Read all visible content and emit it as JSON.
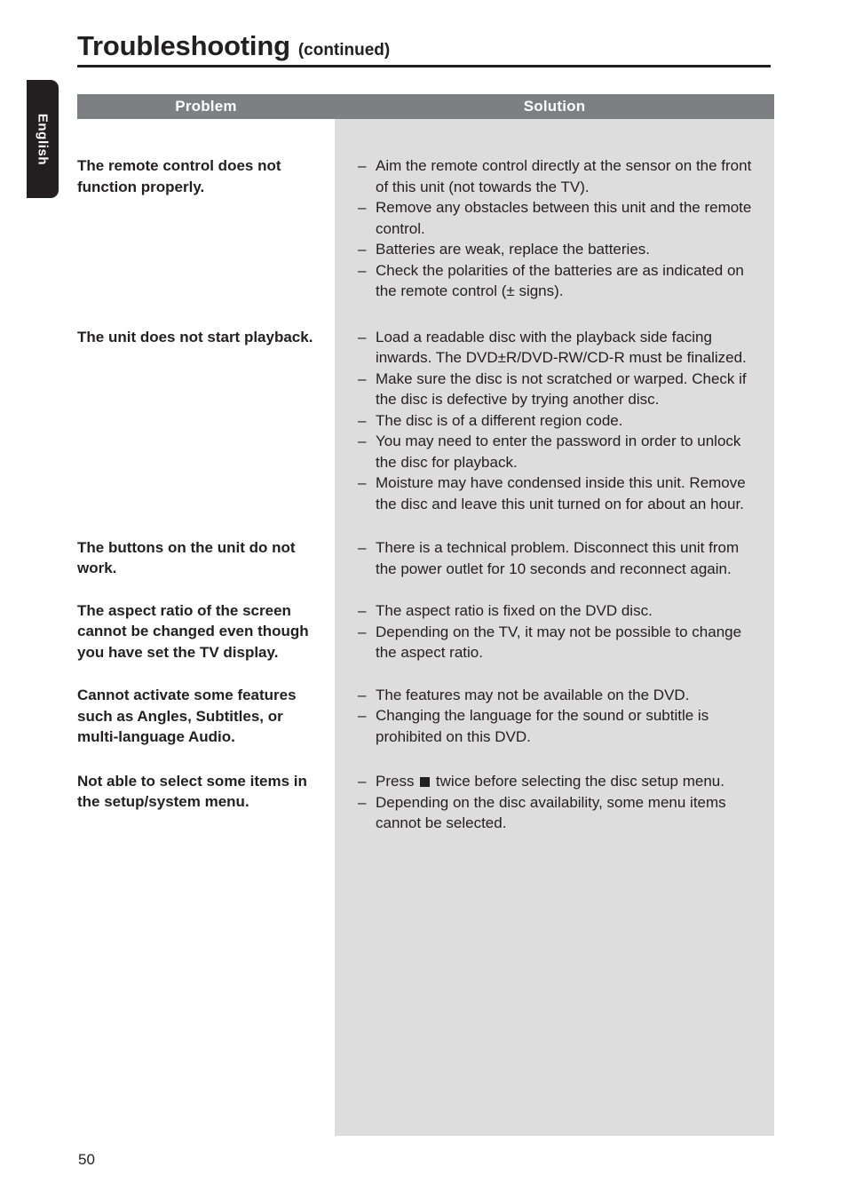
{
  "document": {
    "title": "Troubleshooting",
    "title_suffix": "(continued)",
    "page_number": "50",
    "language_tab": "English",
    "colors": {
      "header_bar": "#7d7f82",
      "solution_column": "#dddddd",
      "text": "#231f20",
      "tab": "#231f20"
    }
  },
  "table": {
    "headers": {
      "problem": "Problem",
      "solution": "Solution"
    },
    "rows": [
      {
        "problem": "The remote control does not function properly.",
        "solutions": [
          "Aim the remote control directly at the sensor on the front of this unit (not towards the TV).",
          "Remove any obstacles between this unit and the remote control.",
          "Batteries are weak, replace the batteries.",
          "Check the polarities of the batteries are as indicated on the remote control (± signs)."
        ]
      },
      {
        "problem": "The unit does not start playback.",
        "solutions": [
          "Load a readable disc with the playback side facing inwards. The DVD±R/DVD-RW/CD-R must be finalized.",
          "Make sure the disc is not scratched or warped. Check if the disc is defective by trying another disc.",
          "The disc is of a different region code.",
          "You may need to enter the password in order to unlock the disc for playback.",
          "Moisture may have condensed inside this unit. Remove the disc and leave this unit turned on for about an hour."
        ]
      },
      {
        "problem": "The buttons on the unit do not work.",
        "solutions": [
          "There is a technical problem. Disconnect this unit from the power outlet for 10 seconds and reconnect again."
        ]
      },
      {
        "problem": "The aspect ratio of the screen cannot be changed even though you have set the TV display.",
        "solutions": [
          "The aspect ratio is fixed on the DVD disc.",
          "Depending on the TV, it may not be possible to change the aspect ratio."
        ]
      },
      {
        "problem": "Cannot activate some features such as Angles, Subtitles, or multi-language Audio.",
        "solutions": [
          "The features may not be available on the DVD.",
          "Changing the language for the sound or subtitle is prohibited on this DVD."
        ]
      },
      {
        "problem": "Not able to select some items in the setup/system menu.",
        "solutions": [
          "Press ■ twice before selecting the disc setup menu.",
          "Depending on the disc availability, some menu items cannot be selected."
        ]
      }
    ],
    "bullet_dash": "–"
  }
}
